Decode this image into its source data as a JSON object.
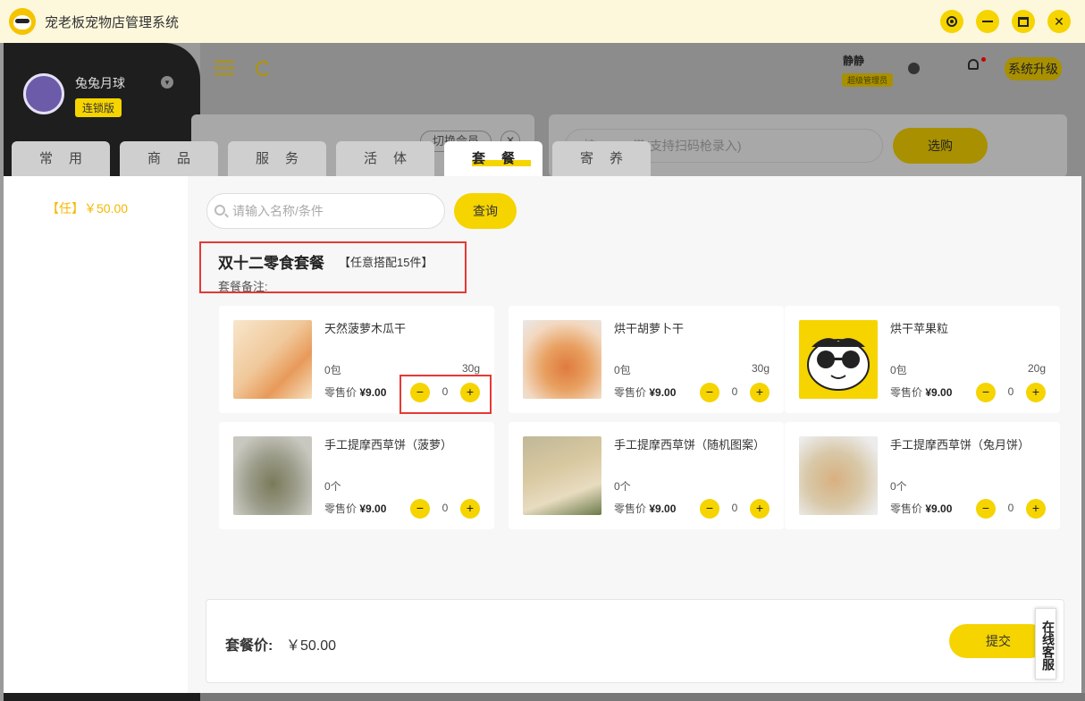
{
  "window": {
    "title": "宠老板宠物店管理系统",
    "buttons": [
      "target-icon",
      "minimize-icon",
      "maximize-icon",
      "close-icon"
    ]
  },
  "background": {
    "store_name": "兔兔月球",
    "store_badge": "连锁版",
    "user_name": "静静",
    "user_role": "超级管理员",
    "upgrade_label": "系统升级",
    "search_placeholder": "按 Enter 键(支持扫码枪录入)",
    "select_label": "选购",
    "switch_member_label": "切换会员"
  },
  "tabs": [
    {
      "label": "常用",
      "active": false
    },
    {
      "label": "商品",
      "active": false
    },
    {
      "label": "服务",
      "active": false
    },
    {
      "label": "活体",
      "active": false
    },
    {
      "label": "套餐",
      "active": true
    },
    {
      "label": "寄养",
      "active": false
    }
  ],
  "category_list": [
    "【任】￥50.00"
  ],
  "search": {
    "placeholder": "请输入名称/条件",
    "value": "",
    "button_label": "查询"
  },
  "package": {
    "title": "双十二零食套餐",
    "subtitle": "【任意搭配15件】",
    "note_label": "套餐备注:"
  },
  "products": [
    {
      "name": "天然菠萝木瓜干",
      "stock": "0包",
      "weight": "30g",
      "price_label": "零售价",
      "price": "¥9.00",
      "qty": "0",
      "thumb_color": "#f0c89a"
    },
    {
      "name": "烘干胡萝卜干",
      "stock": "0包",
      "weight": "30g",
      "price_label": "零售价",
      "price": "¥9.00",
      "qty": "0",
      "thumb_color": "#e8a060"
    },
    {
      "name": "烘干苹果粒",
      "stock": "0包",
      "weight": "20g",
      "price_label": "零售价",
      "price": "¥9.00",
      "qty": "0",
      "thumb_color": "#f5d400"
    },
    {
      "name": "手工提摩西草饼（菠萝）",
      "stock": "0个",
      "weight": "",
      "price_label": "零售价",
      "price": "¥9.00",
      "qty": "0",
      "thumb_color": "#9a9a88"
    },
    {
      "name": "手工提摩西草饼（随机图案）",
      "stock": "0个",
      "weight": "",
      "price_label": "零售价",
      "price": "¥9.00",
      "qty": "0",
      "thumb_color": "#c8b898"
    },
    {
      "name": "手工提摩西草饼（兔月饼）",
      "stock": "0个",
      "weight": "",
      "price_label": "零售价",
      "price": "¥9.00",
      "qty": "0",
      "thumb_color": "#d8c8a8"
    }
  ],
  "stepper": {
    "minus": "−",
    "plus": "+"
  },
  "footer": {
    "total_label": "套餐价:",
    "total_value": "￥50.00",
    "submit_label": "提交",
    "service_label": "在线客服"
  },
  "colors": {
    "accent": "#f5d400",
    "highlight": "#e53935"
  }
}
